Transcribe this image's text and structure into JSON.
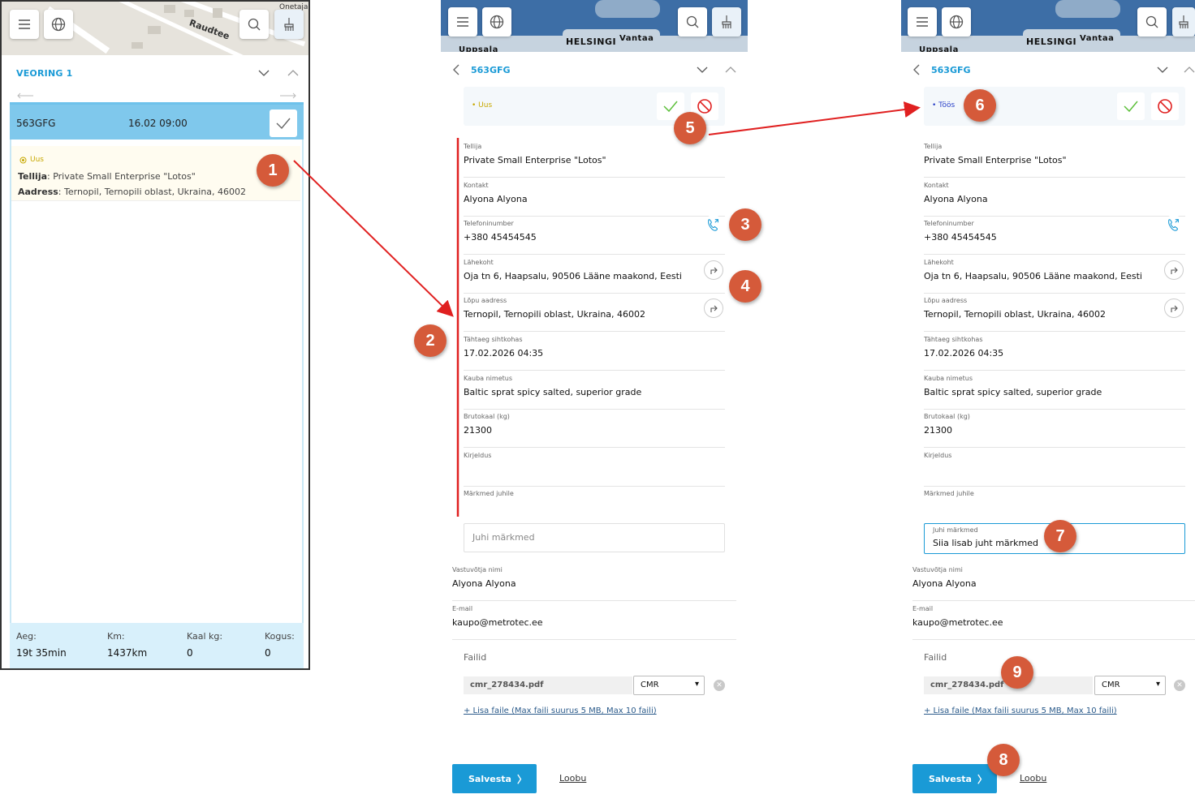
{
  "panel1": {
    "map_label": "Raudtee",
    "map_label_corner": "Onetaja",
    "section_title": "VEORING 1",
    "vehicle": {
      "plate": "563GFG",
      "datetime": "16.02 09:00"
    },
    "order": {
      "status": "Uus",
      "tellija_label": "Tellija",
      "tellija_value": ": Private Small Enterprise \"Lotos\"",
      "aadress_label": "Aadress",
      "aadress_value": ": Ternopil, Ternopili oblast, Ukraina, 46002"
    },
    "stats": [
      {
        "label": "Aeg:",
        "value": "19t 35min"
      },
      {
        "label": "Km:",
        "value": "1437km"
      },
      {
        "label": "Kaal kg:",
        "value": "0"
      },
      {
        "label": "Kogus:",
        "value": "0"
      }
    ]
  },
  "map2": {
    "city": "HELSINGI",
    "city2": "Vantaa",
    "city3": "Uppsala"
  },
  "form": {
    "plate": "563GFG",
    "status_new": "• Uus",
    "status_work": "• Töös",
    "fields": [
      {
        "label": "Tellija",
        "value": "Private Small Enterprise \"Lotos\""
      },
      {
        "label": "Kontakt",
        "value": "Alyona Alyona"
      },
      {
        "label": "Telefoninumber",
        "value": "+380 45454545"
      },
      {
        "label": "Lähekoht",
        "value": "Oja tn 6, Haapsalu, 90506 Lääne maakond, Eesti"
      },
      {
        "label": "Lõpu aadress",
        "value": "Ternopil, Ternopili oblast, Ukraina, 46002"
      },
      {
        "label": "Tähtaeg sihtkohas",
        "value": "17.02.2026 04:35"
      },
      {
        "label": "Kauba nimetus",
        "value": "Baltic sprat spicy salted, superior grade"
      },
      {
        "label": "Brutokaal (kg)",
        "value": "21300"
      },
      {
        "label": "Kirjeldus",
        "value": ""
      },
      {
        "label": "Märkmed juhile",
        "value": ""
      }
    ],
    "juhi_placeholder": "Juhi märkmed",
    "juhi_label": "Juhi märkmed",
    "juhi_value": "Siia lisab juht märkmed",
    "receiver_label": "Vastuvõtja nimi",
    "receiver_value": "Alyona Alyona",
    "email_label": "E-mail",
    "email_value": "kaupo@metrotec.ee",
    "files_label": "Failid",
    "file_name": "cmr_278434.pdf",
    "file_type": "CMR",
    "add_files": "+ Lisa faile (Max faili suurus 5 MB, Max 10 faili)",
    "save": "Salvesta",
    "cancel": "Loobu"
  },
  "callouts": [
    "1",
    "2",
    "3",
    "4",
    "5",
    "6",
    "7",
    "8",
    "9"
  ],
  "colors": {
    "accent": "#1a9ad6",
    "callout": "#d55a3a",
    "arrow": "#e02020"
  }
}
